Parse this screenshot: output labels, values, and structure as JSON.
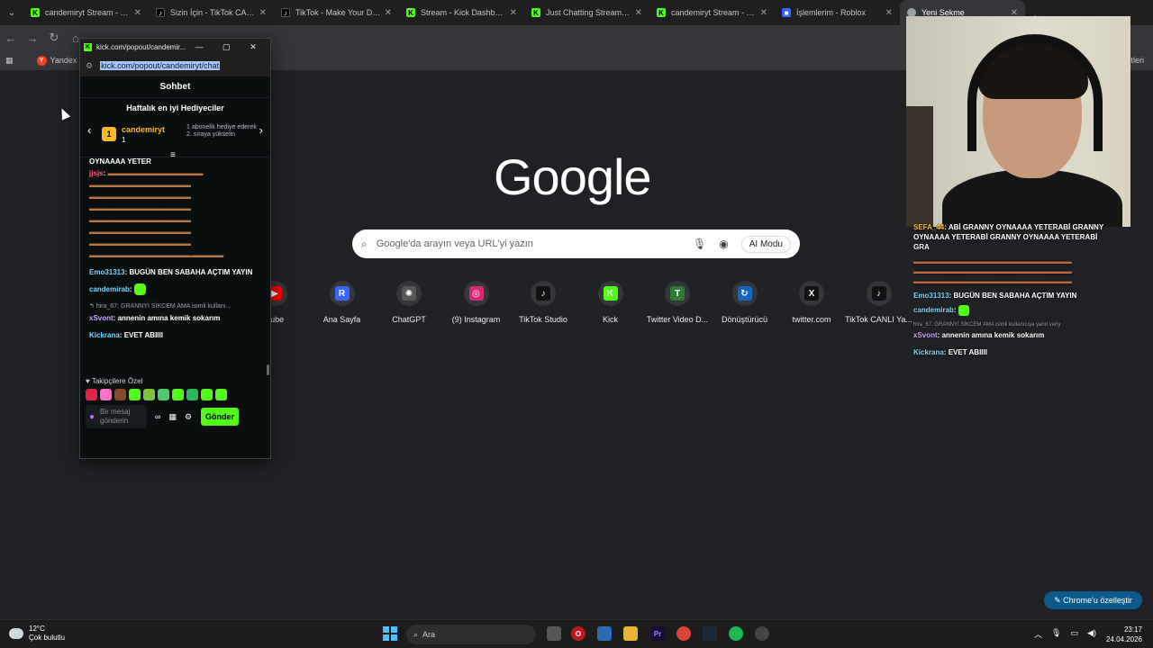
{
  "tabs": [
    {
      "label": "candemiryt Stream - Watc",
      "favicon": "kick-icon",
      "active": false
    },
    {
      "label": "Sizin İçin - TikTok CANLI",
      "favicon": "tiktok-icon",
      "active": false
    },
    {
      "label": "TikTok - Make Your Day",
      "favicon": "tiktok-icon",
      "active": false
    },
    {
      "label": "Stream - Kick Dashboard",
      "favicon": "kick-icon",
      "active": false
    },
    {
      "label": "Just Chatting Streaming -",
      "favicon": "kick-icon",
      "active": false
    },
    {
      "label": "candemiryt Stream - Watc",
      "favicon": "kick-icon",
      "active": false
    },
    {
      "label": "İşlemlerim - Roblox",
      "favicon": "roblox-icon",
      "active": false
    },
    {
      "label": "Yeni Sekme",
      "favicon": "chrome-icon",
      "active": true
    }
  ],
  "bookmarks": {
    "yandex": "Yandex",
    "right_label": "etleri"
  },
  "ntp": {
    "logo": "Google",
    "search_placeholder": "Google'da arayın veya URL'yi yazın",
    "ai_mode": "AI Modu",
    "shortcuts": [
      {
        "label": "Tube",
        "glyph": "▶"
      },
      {
        "label": "Ana Sayfa",
        "glyph": "R"
      },
      {
        "label": "ChatGPT",
        "glyph": "✺"
      },
      {
        "label": "(9) Instagram",
        "glyph": "◎"
      },
      {
        "label": "TikTok Studio",
        "glyph": "♪"
      },
      {
        "label": "Kick",
        "glyph": "K"
      },
      {
        "label": "Twitter Video D...",
        "glyph": "T"
      },
      {
        "label": "Dönüştürücü",
        "glyph": "↻"
      },
      {
        "label": "twitter.com",
        "glyph": "X"
      },
      {
        "label": "TikTok CANLI Ya...",
        "glyph": "♪"
      }
    ],
    "customize": "Chrome'u özelleştir"
  },
  "popup": {
    "window_title": "kick.com/popout/candemir...",
    "url": "kick.com/popout/candemiryt/chat",
    "chat_title": "Sohbet",
    "gifters_header": "Haftalık en iyi Hediyeciler",
    "gifter": {
      "rank": "1",
      "name": "candemiryt",
      "count": "1"
    },
    "gifter_desc": "1 abonelik hediye ederek 2. sıraya yükselin",
    "messages": {
      "clipped_top": "OYNAAAA YETER",
      "jjsjs_user": "jjsjs",
      "emo_user": "Emo31313",
      "emo_text": "BUGÜN BEN SABAHA AÇTIM YAYIN",
      "cand_user": "candemirab",
      "reply_text": "hira_67: GRANNYİ SİKCEM AMA isimli kullanı...",
      "xsvont_user": "xSvont",
      "xsvont_text": "annenin amına kemik sokarım",
      "kick_user": "Kickrana",
      "kick_text": "EVET ABIIII"
    },
    "follower_label": "Takipçilere Özel",
    "input_placeholder": "Bir mesaj gönderin",
    "send_label": "Gönder"
  },
  "overlay_chat": {
    "top_clipped": "SEFA_44 ...",
    "sefa_user": "SEFA_44",
    "sefa_text": "ABİ GRANNY OYNAAAA YETERABİ GRANNY OYNAAAA YETERABİ GRANNY OYNAAAA YETERABİ GRA",
    "emo_user": "Emo31313",
    "emo_text": "BUGÜN BEN SABAHA AÇTIM YAYIN",
    "cand_user": "candemirab",
    "reply": "hira_67: GRANNYİ SİKCEM AMA isimli kullanıcıya yanıt veriy",
    "xsvont_user": "xSvont",
    "xsvont_text": "annenin amına kemik sokarım",
    "kick_user": "Kickrana",
    "kick_text": "EVET ABIIII"
  },
  "taskbar": {
    "temp": "12°C",
    "weather": "Çok bulutlu",
    "search": "Ara",
    "time": "23:17",
    "date": "24.04.2026"
  },
  "colors": {
    "kick_green": "#53fc18",
    "gifter_gold": "#f4b82a",
    "accent_blue": "#0d5a8a"
  }
}
